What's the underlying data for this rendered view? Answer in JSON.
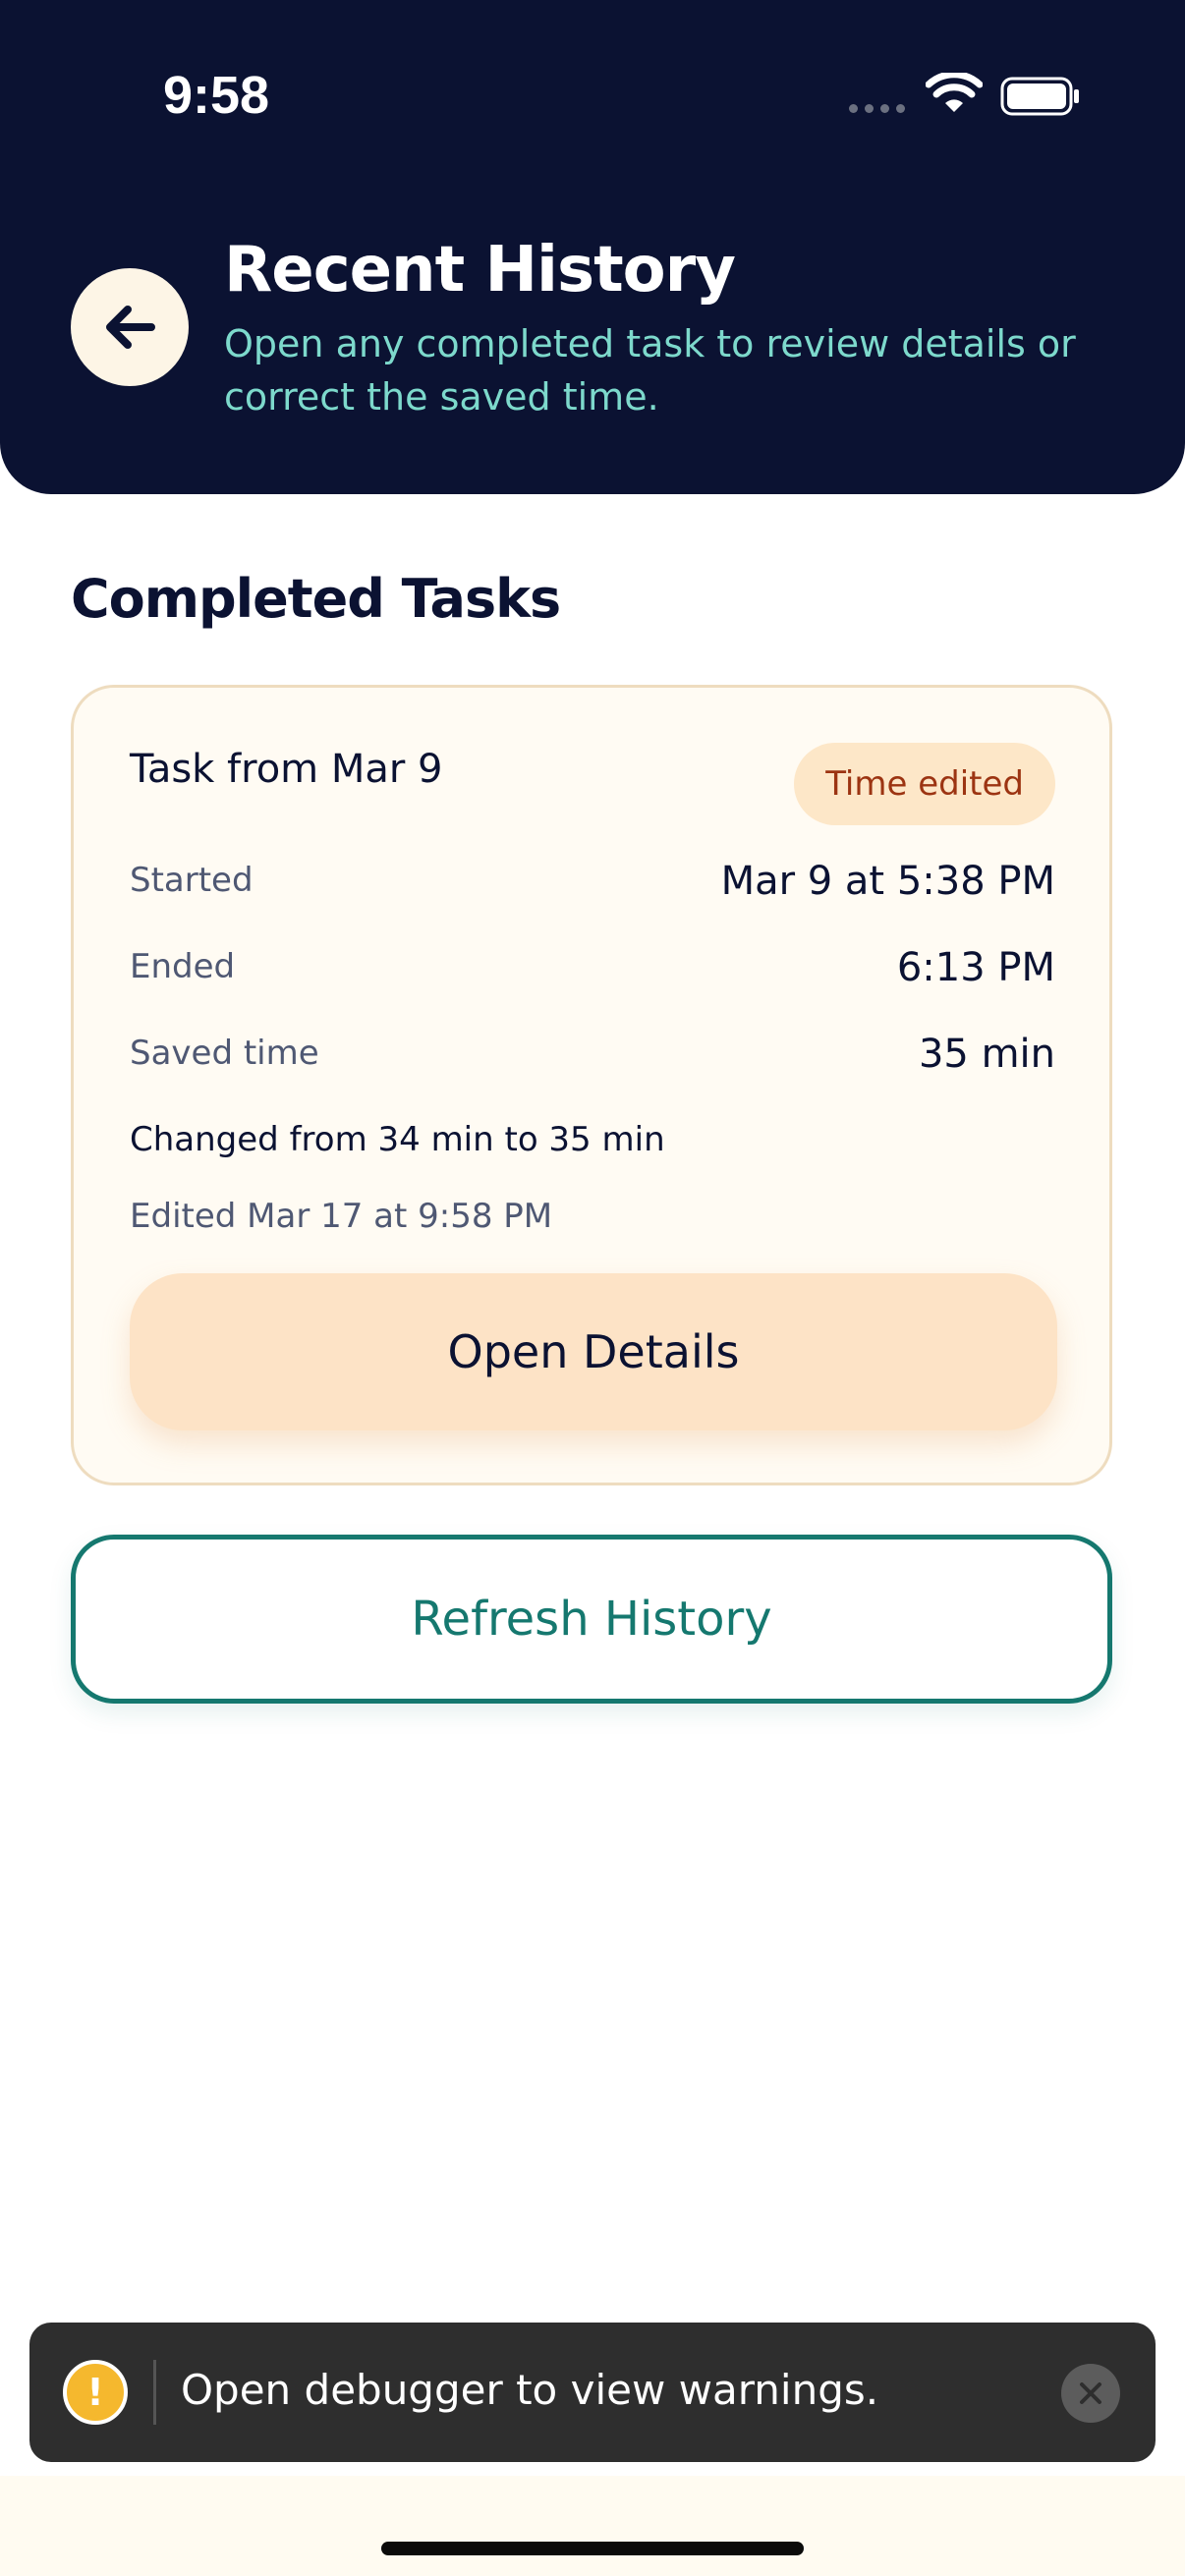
{
  "status_bar": {
    "time": "9:58"
  },
  "header": {
    "title": "Recent History",
    "subtitle": "Open any completed task to review details or correct the saved time."
  },
  "section": {
    "title": "Completed Tasks"
  },
  "task_card": {
    "title": "Task from Mar 9",
    "badge": "Time edited",
    "rows": [
      {
        "label": "Started",
        "value": "Mar 9 at 5:38 PM"
      },
      {
        "label": "Ended",
        "value": "6:13 PM"
      },
      {
        "label": "Saved time",
        "value": "35 min"
      }
    ],
    "change_note": "Changed from 34 min to 35 min",
    "edited_note": "Edited Mar 17 at 9:58 PM",
    "open_button": "Open Details"
  },
  "refresh_button": "Refresh History",
  "debug_toast": {
    "message": "Open debugger to view warnings.",
    "icon": "!"
  },
  "colors": {
    "header_bg": "#0b1232",
    "accent_teal": "#15786f",
    "subtitle_teal": "#7dd9cc",
    "badge_bg": "#fde7c8",
    "badge_text": "#9c3412",
    "card_bg": "#fffbf3",
    "open_button_bg": "#fde3c6"
  }
}
